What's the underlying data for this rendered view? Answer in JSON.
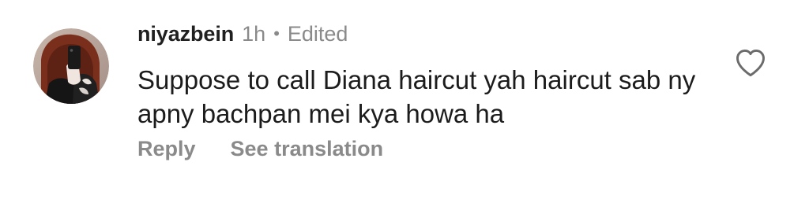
{
  "comment": {
    "avatar_icon": "profile-photo",
    "username": "niyazbein",
    "time": "1h",
    "separator": "•",
    "edited": "Edited",
    "text": "Suppose to call Diana haircut yah haircut sab ny apny bachpan mei kya howa ha",
    "actions": {
      "reply": "Reply",
      "see_translation": "See translation"
    },
    "like_icon": "heart-outline-icon",
    "colors": {
      "meta_gray": "#8a8a8a",
      "text": "#1c1c1c",
      "username": "#202020"
    }
  }
}
